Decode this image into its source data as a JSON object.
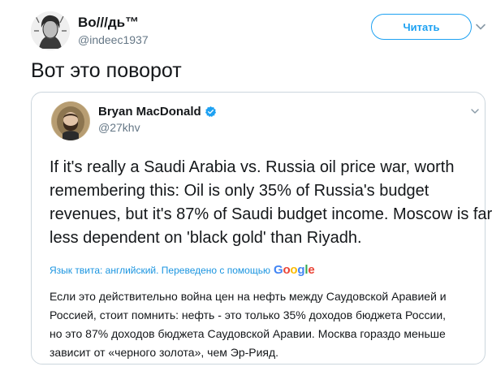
{
  "author": {
    "display_name": "Во///дь™",
    "handle": "@indeec1937",
    "follow_label": "Читать"
  },
  "tweet": {
    "text": "Вот это поворот"
  },
  "quoted": {
    "display_name": "Bryan MacDonald",
    "handle": "@27khv",
    "verified": true,
    "body_lines": [
      "If it's really a Saudi Arabia vs. Russia oil price war, worth",
      "remembering this: Oil is only 35% of Russia's budget",
      "revenues, but it's 87% of Saudi budget income. Moscow is far",
      "less dependent on 'black gold' than Riyadh."
    ],
    "translation_label": "Язык твита: английский. Переведено с помощью",
    "translation_provider": "Google",
    "translated_lines": [
      "Если это действительно война цен на нефть между Саудовской Аравией и",
      "Россией, стоит помнить: нефть - это только 35% доходов бюджета России,",
      "но это 87% доходов бюджета Саудовской Аравии. Москва гораздо меньше",
      "зависит от «черного золота», чем Эр-Рияд."
    ]
  },
  "colors": {
    "accent": "#1da1f2",
    "link": "#1b95e0",
    "text": "#14171a",
    "secondary": "#657786",
    "border": "#ccd6dd"
  }
}
